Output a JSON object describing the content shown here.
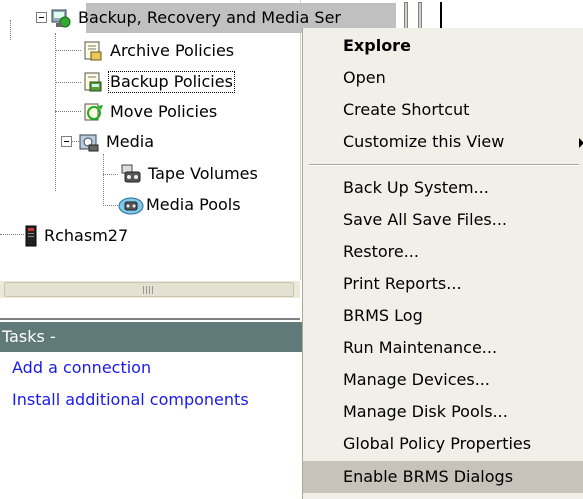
{
  "tree": {
    "root_label": "Backup, Recovery and Media Ser",
    "items": [
      {
        "label": "Archive Policies",
        "icon": "archive-policies-icon"
      },
      {
        "label": "Backup Policies",
        "icon": "backup-policies-icon"
      },
      {
        "label": "Move Policies",
        "icon": "move-policies-icon"
      },
      {
        "label": "Media",
        "icon": "media-folder-icon"
      },
      {
        "label": "Tape Volumes",
        "icon": "tape-volumes-icon"
      },
      {
        "label": "Media Pools",
        "icon": "media-pools-icon"
      }
    ],
    "system_label": "Rchasm27"
  },
  "tasks": {
    "header": "Tasks -",
    "links": [
      "Add a connection",
      "Install additional components"
    ]
  },
  "menu": {
    "items": [
      "Explore",
      "Open",
      "Create Shortcut",
      "Customize this View",
      "Back Up System...",
      "Save All Save Files...",
      "Restore...",
      "Print Reports...",
      "BRMS Log",
      "Run Maintenance...",
      "Manage Devices...",
      "Manage Disk Pools...",
      "Global Policy Properties",
      "Enable BRMS Dialogs"
    ]
  },
  "colors": {
    "tasks_header_bg": "#5f7a78",
    "link": "#1a1ae6",
    "menu_bg": "#f0efe8",
    "menu_highlight": "#c7c3bb"
  }
}
